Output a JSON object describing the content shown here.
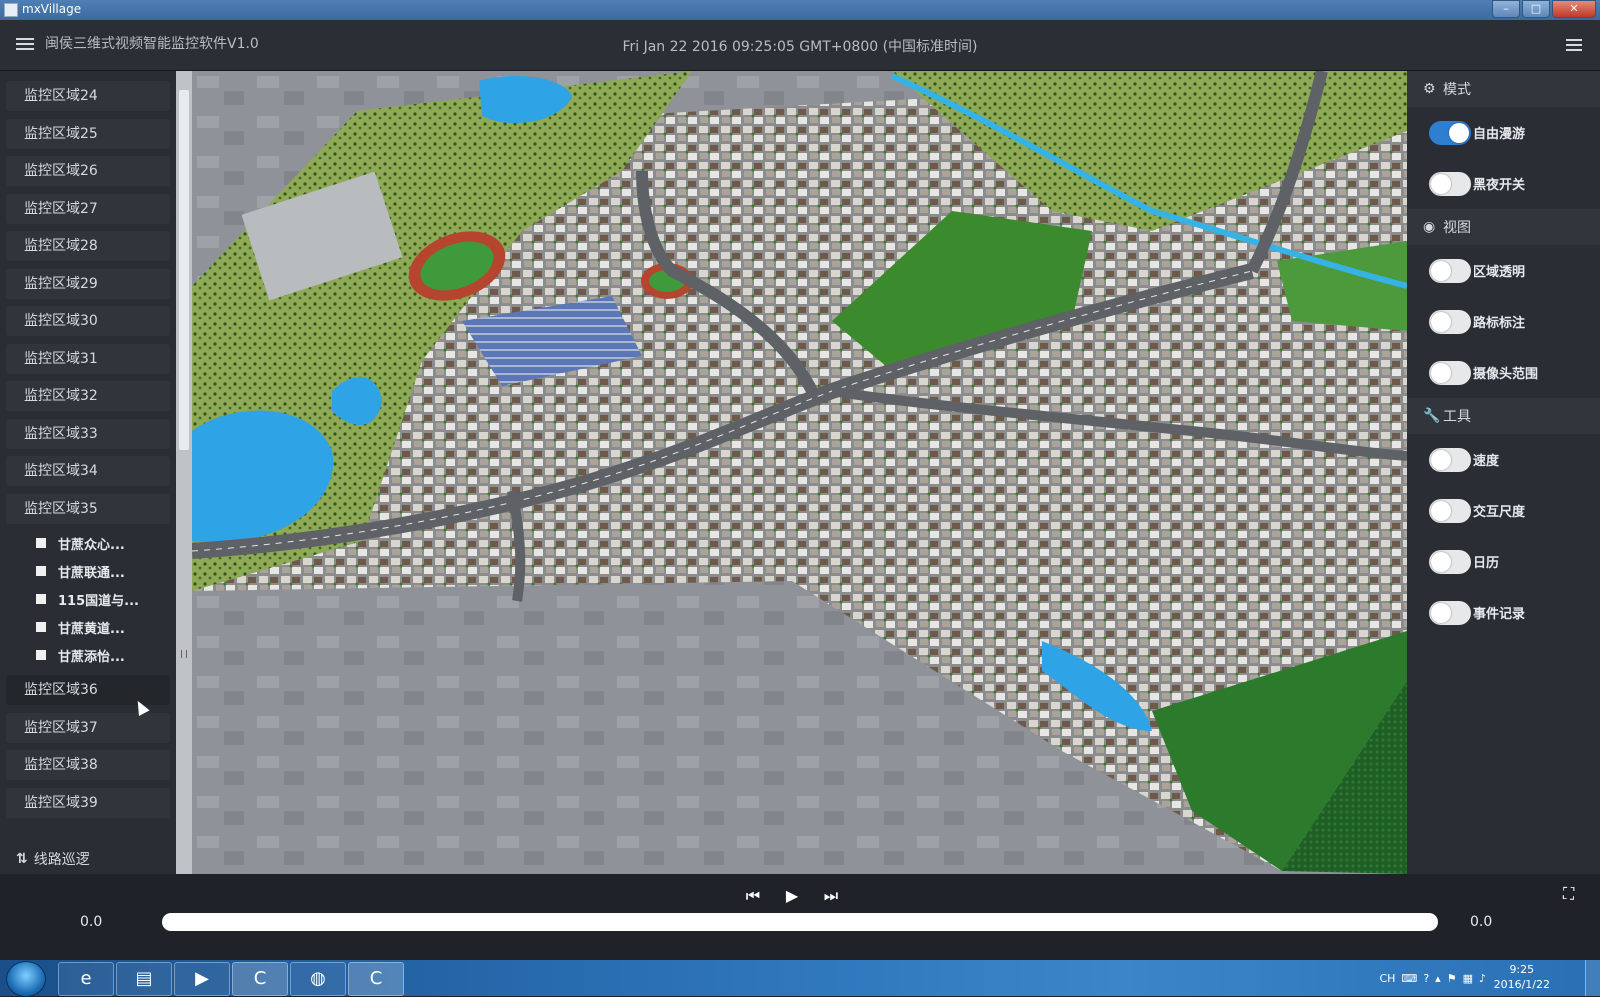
{
  "window": {
    "title": "mxVillage",
    "minimize": "–",
    "maximize": "□",
    "close": "✕"
  },
  "header": {
    "app_title": "闽侯三维式视频智能监控软件V1.0",
    "datetime": "Fri Jan 22 2016 09:25:05 GMT+0800 (中国标准时间)"
  },
  "sidebar": {
    "regions_before": [
      "监控区域24",
      "监控区域25",
      "监控区域26",
      "监控区域27",
      "监控区域28",
      "监控区域29",
      "监控区域30",
      "监控区域31",
      "监控区域32",
      "监控区域33",
      "监控区域34",
      "监控区域35"
    ],
    "expanded_children": [
      "甘蔗众心...",
      "甘蔗联通...",
      "115国道与...",
      "甘蔗黄道...",
      "甘蔗添怡..."
    ],
    "regions_after": [
      "监控区域36",
      "监控区域37",
      "监控区域38",
      "监控区域39"
    ],
    "hovered_region": "监控区域36",
    "route_patrol": "线路巡逻"
  },
  "right_panel": {
    "mode": {
      "title": "模式",
      "icon": "gear-icon",
      "toggles": [
        {
          "label": "自由漫游",
          "on": true
        },
        {
          "label": "黑夜开关",
          "on": false
        }
      ]
    },
    "view": {
      "title": "视图",
      "icon": "eye-icon",
      "toggles": [
        {
          "label": "区域透明",
          "on": false
        },
        {
          "label": "路标标注",
          "on": false
        },
        {
          "label": "摄像头范围",
          "on": false
        }
      ]
    },
    "tools": {
      "title": "工具",
      "icon": "wrench-icon",
      "toggles": [
        {
          "label": "速度",
          "on": false
        },
        {
          "label": "交互尺度",
          "on": false
        },
        {
          "label": "日历",
          "on": false
        },
        {
          "label": "事件记录",
          "on": false
        }
      ]
    }
  },
  "playback": {
    "prev": "⏮",
    "play": "▶",
    "next": "⏭",
    "fullscreen": "⛶",
    "time_left": "0.0",
    "time_right": "0.0",
    "progress": 0
  },
  "taskbar": {
    "apps": [
      "ie-icon",
      "folder-icon",
      "media-player-icon",
      "camtasia-icon",
      "network-icon",
      "camtasia-recorder-icon"
    ],
    "tray_lang": "CH",
    "time": "9:25",
    "date": "2016/1/22"
  },
  "colors": {
    "accent": "#2f7fd1",
    "panel": "#2a2e34",
    "header": "#2b2f35"
  }
}
